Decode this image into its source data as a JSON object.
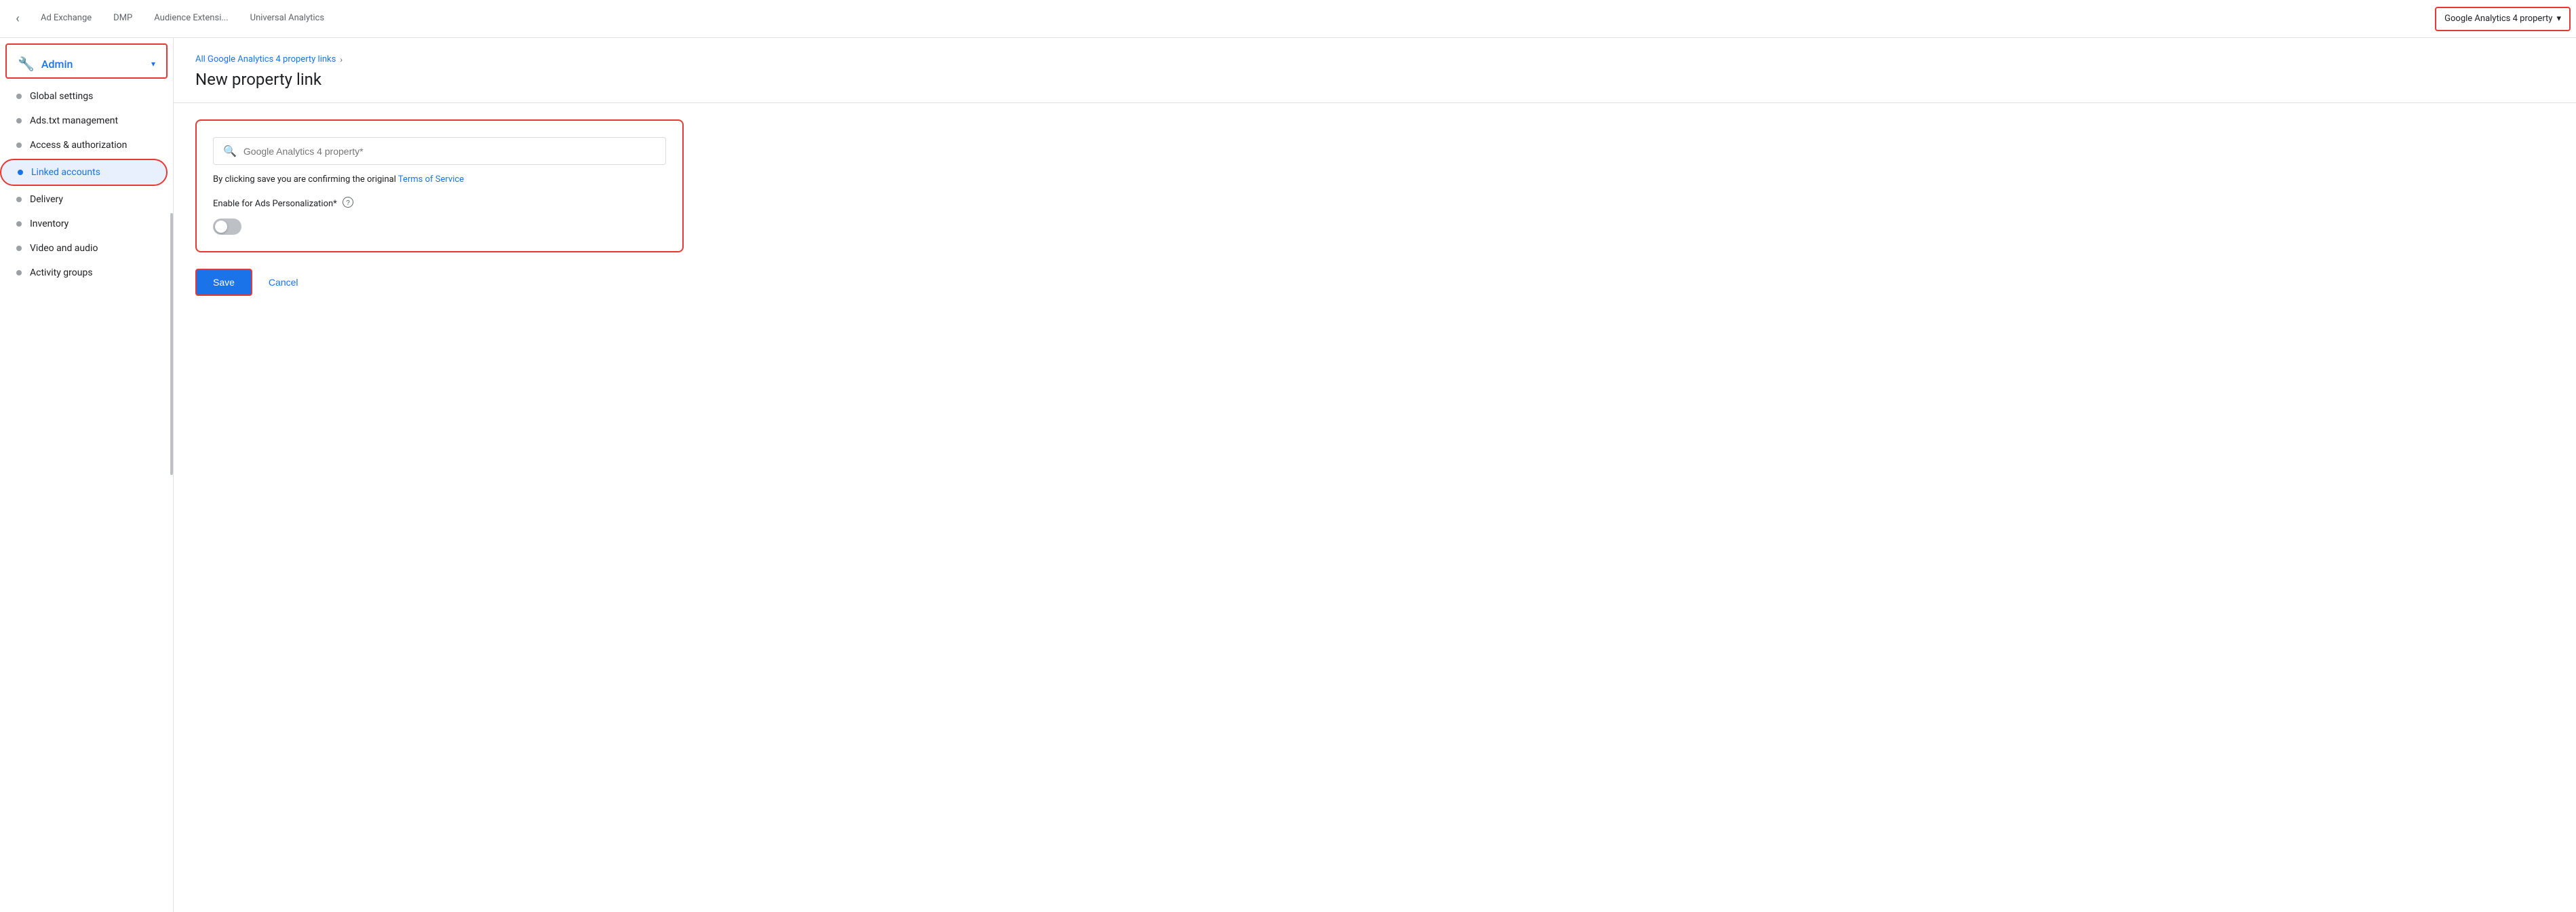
{
  "topnav": {
    "tabs": [
      {
        "label": "Ad Exchange",
        "active": false
      },
      {
        "label": "DMP",
        "active": false
      },
      {
        "label": "Audience Extensi...",
        "active": false
      },
      {
        "label": "Universal Analytics",
        "active": false
      }
    ],
    "dropdown": {
      "label": "Google Analytics 4 property",
      "active": true
    }
  },
  "sidebar": {
    "admin_label": "Admin",
    "admin_icon": "⚙",
    "items": [
      {
        "label": "Global settings",
        "active": false,
        "id": "global-settings"
      },
      {
        "label": "Ads.txt management",
        "active": false,
        "id": "ads-txt"
      },
      {
        "label": "Access & authorization",
        "active": false,
        "id": "access-auth"
      },
      {
        "label": "Linked accounts",
        "active": true,
        "id": "linked-accounts"
      },
      {
        "label": "Delivery",
        "active": false,
        "id": "delivery"
      },
      {
        "label": "Inventory",
        "active": false,
        "id": "inventory"
      },
      {
        "label": "Video and audio",
        "active": false,
        "id": "video-audio"
      },
      {
        "label": "Activity groups",
        "active": false,
        "id": "activity-groups"
      }
    ]
  },
  "breadcrumb": {
    "link_text": "All Google Analytics 4 property links",
    "separator": "›"
  },
  "page": {
    "title": "New property link"
  },
  "form": {
    "search_placeholder": "Google Analytics 4 property*",
    "terms_text": "By clicking save you are confirming the original",
    "terms_link": "Terms of Service",
    "toggle_label": "Enable for Ads Personalization*",
    "toggle_enabled": false
  },
  "actions": {
    "save_label": "Save",
    "cancel_label": "Cancel"
  },
  "icons": {
    "back": "‹",
    "chevron_down": "▾",
    "search": "🔍",
    "help": "?",
    "wrench": "🔧"
  }
}
